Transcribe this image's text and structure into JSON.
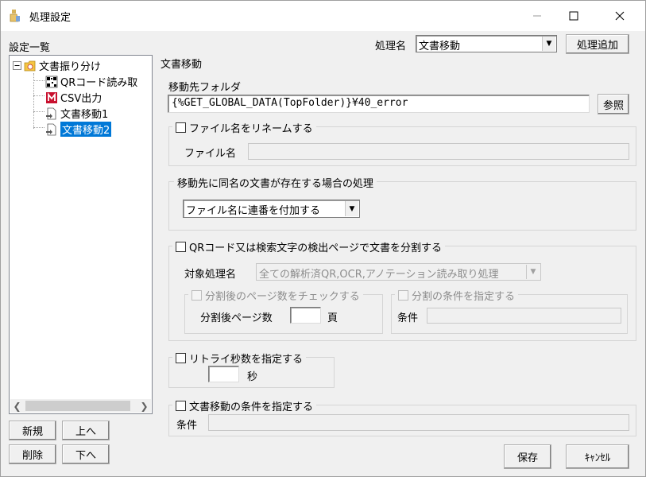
{
  "window": {
    "title": "処理設定"
  },
  "left": {
    "list_label": "設定一覧",
    "tree": {
      "root": "文書振り分け",
      "children": [
        "QRコード読み取",
        "CSV出力",
        "文書移動1",
        "文書移動2"
      ]
    },
    "buttons": {
      "new": "新規",
      "up": "上へ",
      "delete": "削除",
      "down": "下へ"
    }
  },
  "header": {
    "process_name_label": "処理名",
    "process_name_value": "文書移動",
    "add_button": "処理追加"
  },
  "section_title": "文書移動",
  "dest_folder": {
    "label": "移動先フォルダ",
    "value": "{%GET_GLOBAL_DATA(TopFolder)}¥40_error",
    "browse_button": "参照"
  },
  "rename": {
    "checkbox_label": "ファイル名をリネームする",
    "filename_label": "ファイル名",
    "filename_value": ""
  },
  "duplicate": {
    "group_label": "移動先に同名の文書が存在する場合の処理",
    "selected": "ファイル名に連番を付加する"
  },
  "split": {
    "checkbox_label": "QRコード又は検索文字の検出ページで文書を分割する",
    "target_label": "対象処理名",
    "target_value": "全ての解析済QR,OCR,アノテーション読み取り処理",
    "page_check_label": "分割後のページ数をチェックする",
    "page_count_label": "分割後ページ数",
    "page_count_value": "",
    "page_unit": "頁",
    "cond_check_label": "分割の条件を指定する",
    "cond_label": "条件",
    "cond_value": ""
  },
  "retry": {
    "checkbox_label": "リトライ秒数を指定する",
    "value": "",
    "unit": "秒"
  },
  "move_cond": {
    "checkbox_label": "文書移動の条件を指定する",
    "cond_label": "条件",
    "cond_value": ""
  },
  "footer": {
    "save": "保存",
    "cancel": "ｷｬﾝｾﾙ"
  },
  "colors": {
    "selection": "#0078d7",
    "folder": "#f5c542"
  }
}
